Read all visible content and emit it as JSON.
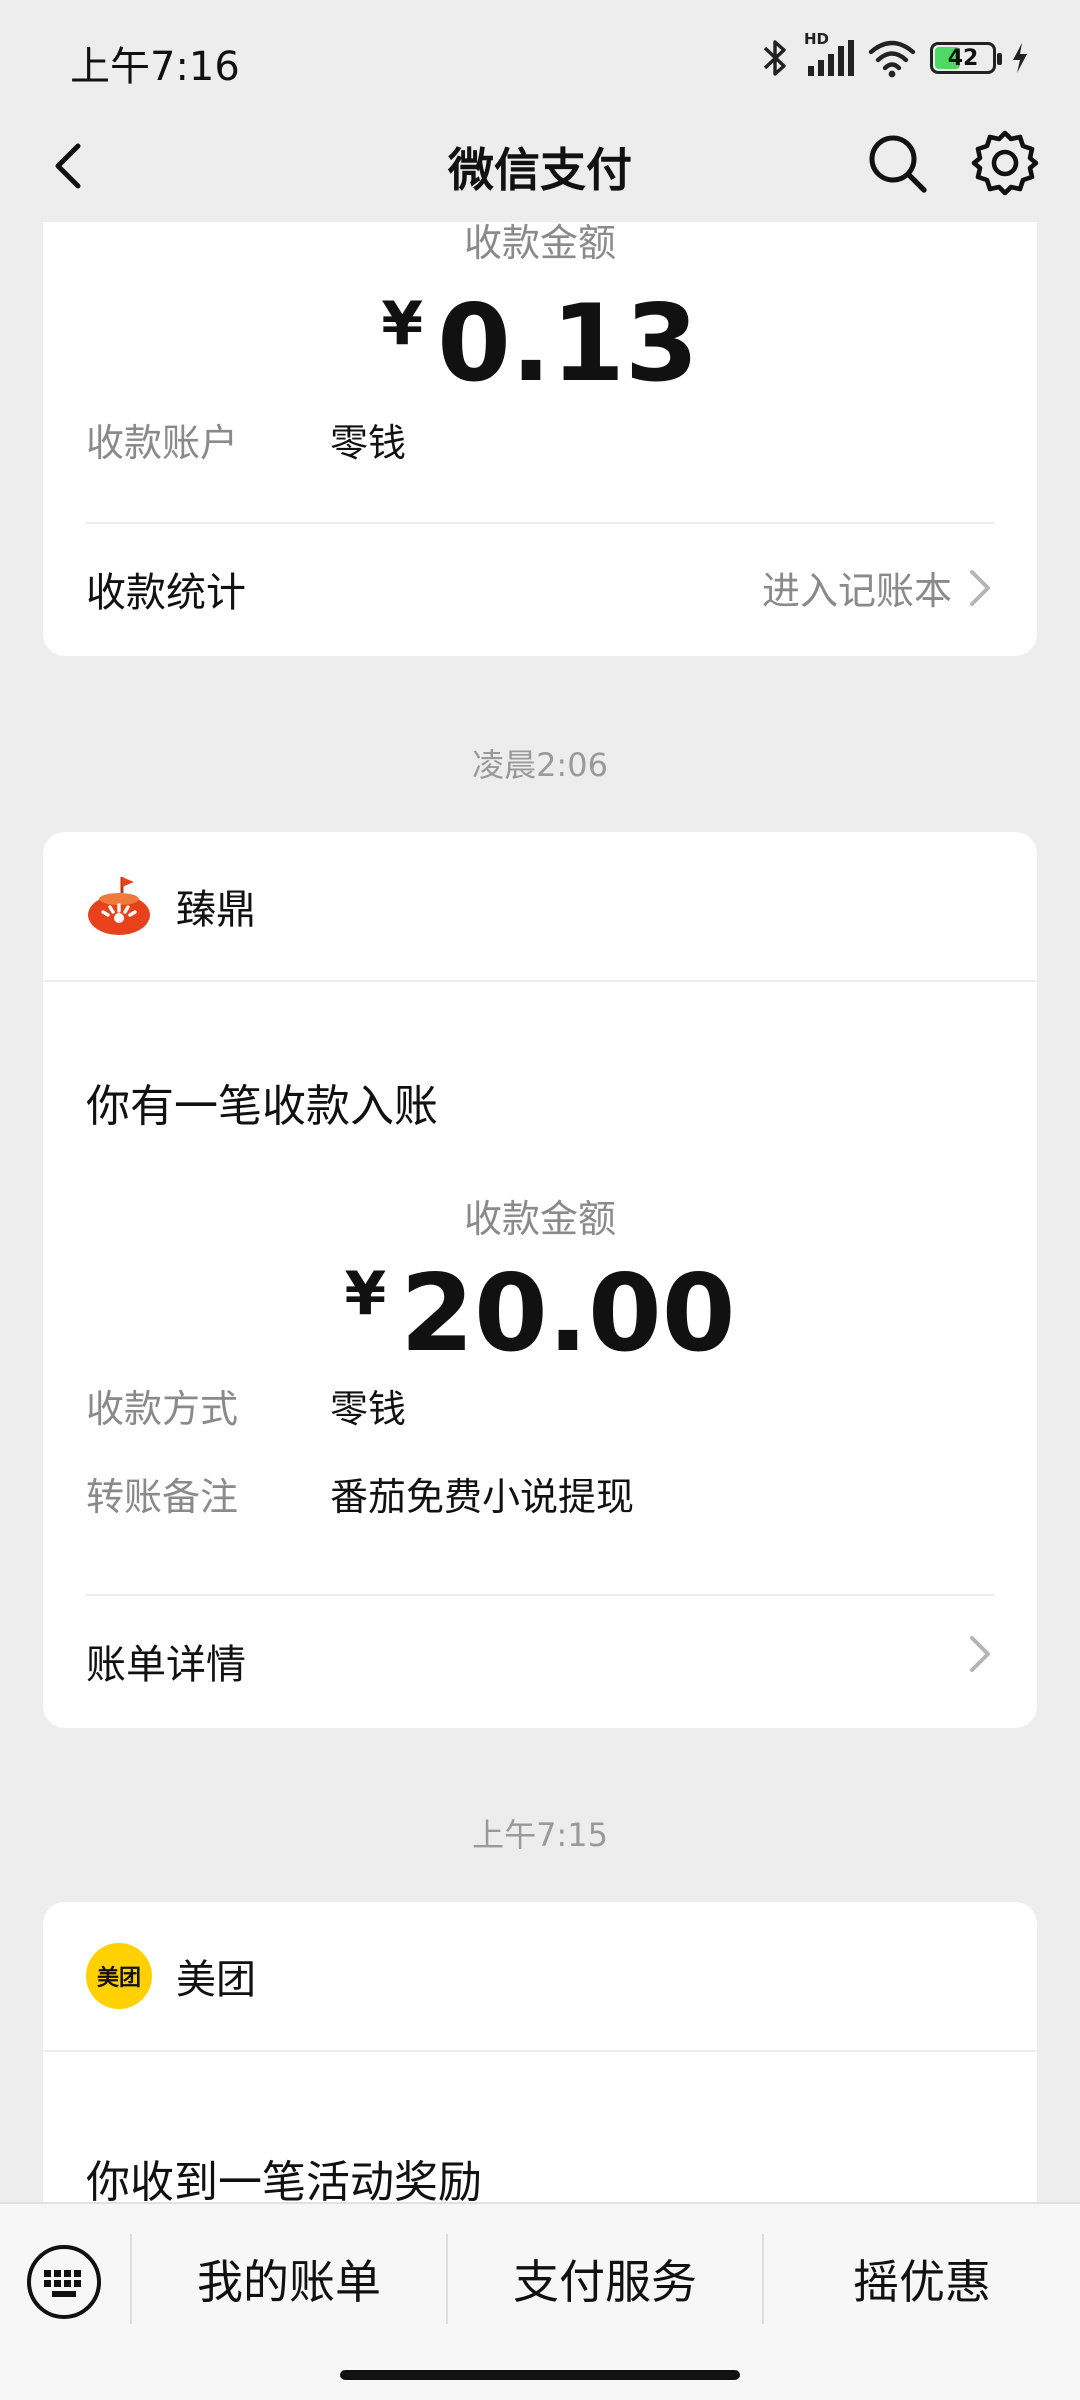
{
  "status_bar": {
    "time": "上午7:16",
    "network_badge": "HD",
    "battery_level": "42",
    "icons": [
      "bluetooth-icon",
      "signal-icon",
      "wifi-icon",
      "battery-icon",
      "charging-icon"
    ]
  },
  "nav": {
    "title": "微信支付",
    "icons": [
      "back-arrow-icon",
      "search-icon",
      "gear-icon"
    ]
  },
  "messages": [
    {
      "amount_label": "收款金额",
      "currency": "¥",
      "amount": "0.13",
      "rows": [
        {
          "label": "收款账户",
          "value": "零钱"
        }
      ],
      "link_label": "收款统计",
      "link_sub": "进入记账本"
    },
    {
      "time": "凌晨2:06",
      "brand": "臻鼎",
      "heading": "你有一笔收款入账",
      "amount_label": "收款金额",
      "currency": "¥",
      "amount": "20.00",
      "rows": [
        {
          "label": "收款方式",
          "value": "零钱"
        },
        {
          "label": "转账备注",
          "value": "番茄免费小说提现"
        }
      ],
      "link_label": "账单详情"
    },
    {
      "time": "上午7:15",
      "brand": "美团",
      "brand_logo_text": "美团",
      "heading": "你收到一笔活动奖励"
    }
  ],
  "tab_bar": {
    "items": [
      "我的账单",
      "支付服务",
      "摇优惠"
    ]
  },
  "colors": {
    "background": "#ededed",
    "card": "#ffffff",
    "meituan_yellow": "#ffd100",
    "tomato_red": "#e8421c"
  }
}
